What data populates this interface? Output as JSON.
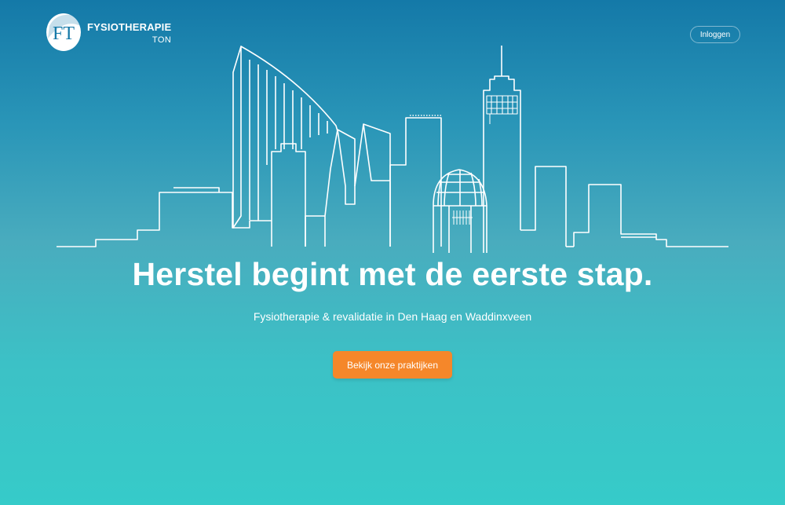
{
  "header": {
    "logo_title": "FYSIOTHERAPIE",
    "logo_sub": "TON",
    "logo_monogram": "FT",
    "login_label": "Inloggen"
  },
  "hero": {
    "headline": "Herstel begint met de eerste stap.",
    "subline": "Fysiotherapie & revalidatie in Den Haag en Waddinxveen",
    "cta_label": "Bekijk onze praktijken"
  },
  "colors": {
    "cta": "#f5872a",
    "gradient_top": "#1479a8",
    "gradient_bottom": "#36cbc9",
    "line": "#ffffff"
  }
}
